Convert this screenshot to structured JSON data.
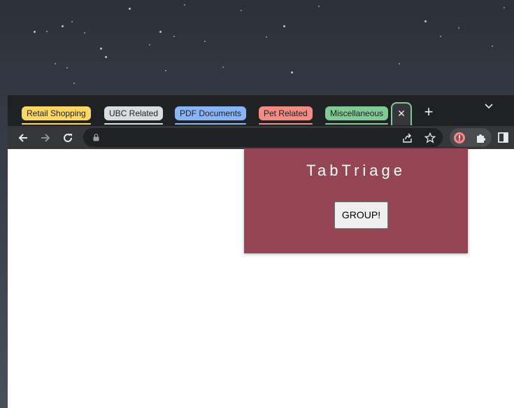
{
  "tab_groups": [
    {
      "label": "Retail Shopping",
      "color": "#fdd663"
    },
    {
      "label": "UBC Related",
      "color": "#dadce0"
    },
    {
      "label": "PDF Documents",
      "color": "#8ab4f8"
    },
    {
      "label": "Pet Related",
      "color": "#f28b82"
    },
    {
      "label": "Miscellaneous",
      "color": "#81c995"
    }
  ],
  "active_tab": {
    "close_glyph": "✕"
  },
  "new_tab": {
    "glyph": "+"
  },
  "omnibox": {
    "url": ""
  },
  "popup": {
    "title": "TabTriage",
    "button_label": "GROUP!",
    "background": "#964554"
  },
  "icons": [
    "tab-search-icon",
    "back-icon",
    "forward-icon",
    "reload-icon",
    "lock-icon",
    "share-icon",
    "bookmark-star-icon",
    "tabtriage-extension-icon",
    "extensions-puzzle-icon",
    "side-panel-icon"
  ]
}
